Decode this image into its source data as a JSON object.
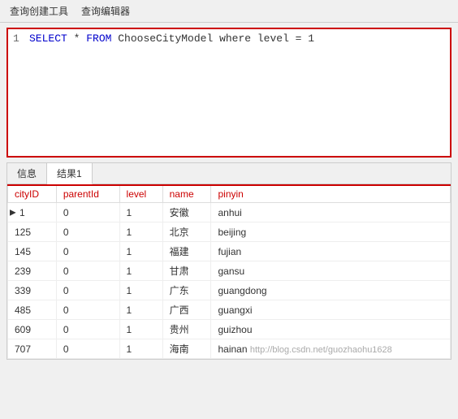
{
  "menu": {
    "items": [
      {
        "label": "查询创建工具"
      },
      {
        "label": "查询编辑器"
      }
    ]
  },
  "editor": {
    "line_number": "1",
    "sql": {
      "select": "SELECT",
      "star": " * ",
      "from": "FROM",
      "table": " ChooseCityModel ",
      "where": "where",
      "condition": " level = 1"
    }
  },
  "bottom": {
    "tabs": [
      {
        "label": "信息",
        "active": false
      },
      {
        "label": "结果1",
        "active": true
      }
    ],
    "table": {
      "headers": [
        "cityID",
        "parentId",
        "level",
        "name",
        "pinyin"
      ],
      "rows": [
        {
          "cityID": "1",
          "parentId": "0",
          "level": "1",
          "name": "安徽",
          "pinyin": "anhui",
          "indicator": true
        },
        {
          "cityID": "125",
          "parentId": "0",
          "level": "1",
          "name": "北京",
          "pinyin": "beijing",
          "indicator": false
        },
        {
          "cityID": "145",
          "parentId": "0",
          "level": "1",
          "name": "福建",
          "pinyin": "fujian",
          "indicator": false
        },
        {
          "cityID": "239",
          "parentId": "0",
          "level": "1",
          "name": "甘肃",
          "pinyin": "gansu",
          "indicator": false
        },
        {
          "cityID": "339",
          "parentId": "0",
          "level": "1",
          "name": "广东",
          "pinyin": "guangdong",
          "indicator": false
        },
        {
          "cityID": "485",
          "parentId": "0",
          "level": "1",
          "name": "广西",
          "pinyin": "guangxi",
          "indicator": false
        },
        {
          "cityID": "609",
          "parentId": "0",
          "level": "1",
          "name": "贵州",
          "pinyin": "guizhou",
          "indicator": false
        },
        {
          "cityID": "707",
          "parentId": "0",
          "level": "1",
          "name": "海南",
          "pinyin": "hainan",
          "indicator": false
        }
      ]
    }
  }
}
